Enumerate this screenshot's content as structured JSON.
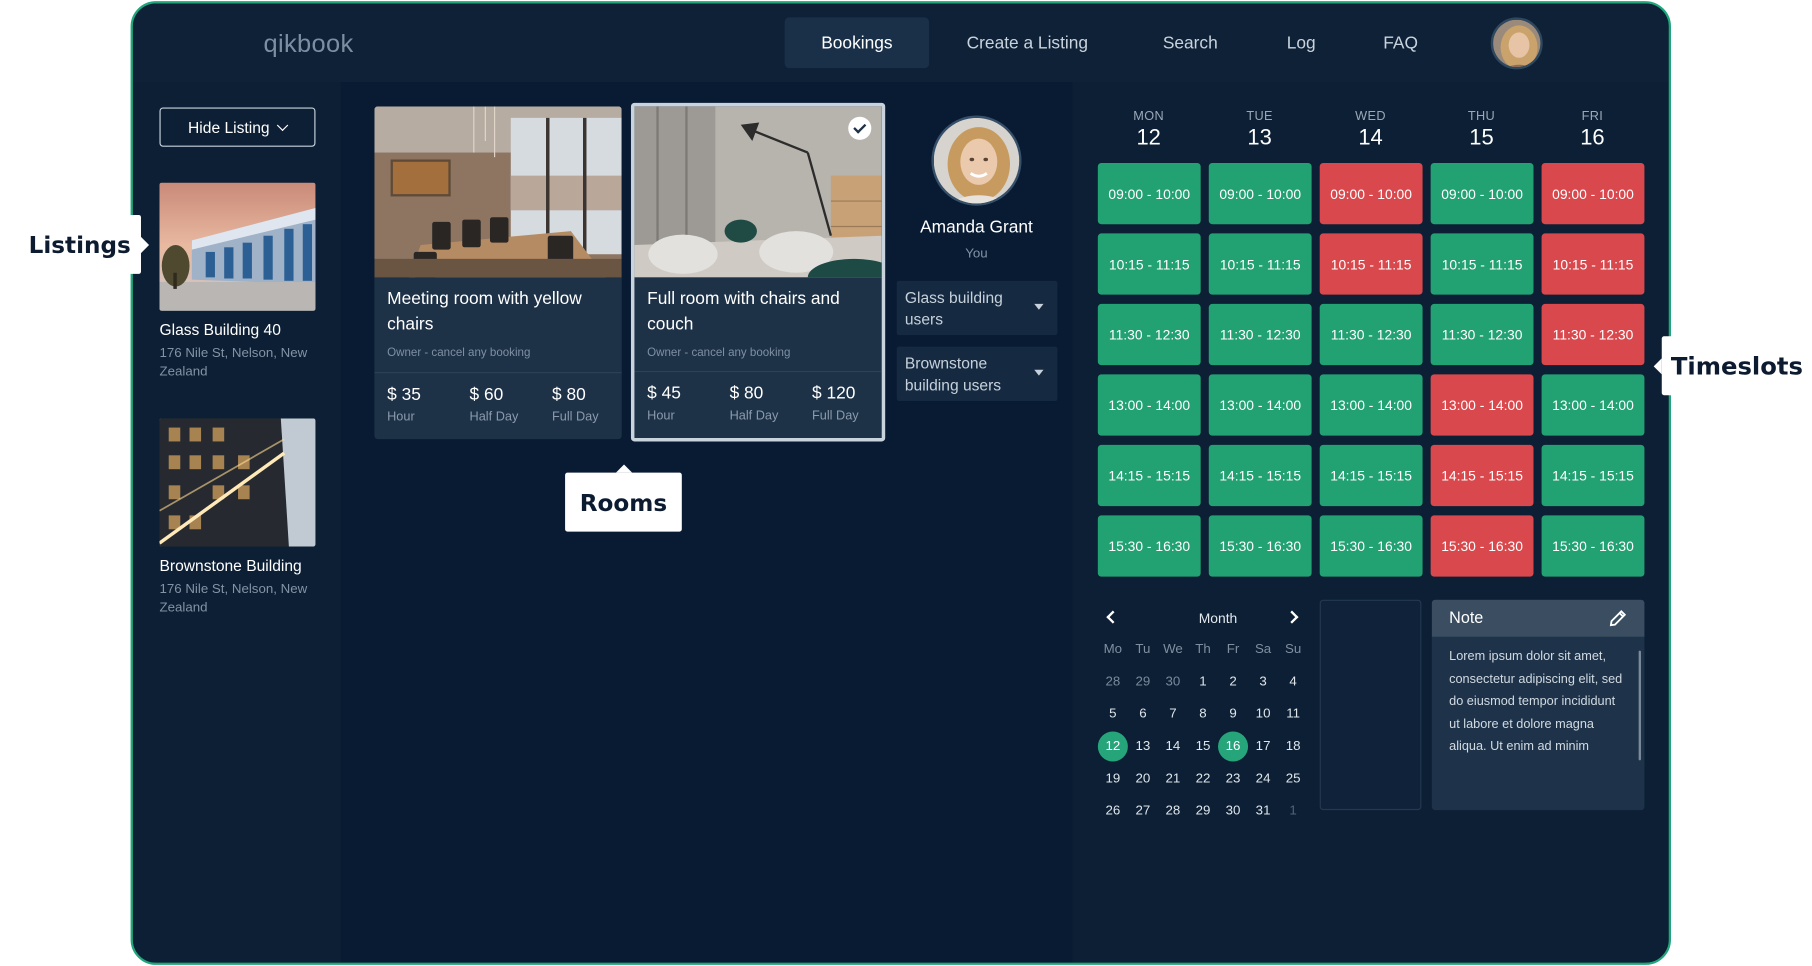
{
  "app": {
    "logo": "qikbook"
  },
  "nav": [
    {
      "label": "Bookings",
      "active": true
    },
    {
      "label": "Create a Listing"
    },
    {
      "label": "Search"
    },
    {
      "label": "Log"
    },
    {
      "label": "FAQ"
    }
  ],
  "sidebar": {
    "hide_button": "Hide Listing",
    "listings": [
      {
        "name": "Glass Building 40",
        "address": "176 Nile St, Nelson, New Zealand"
      },
      {
        "name": "Brownstone Building",
        "address": "176 Nile St, Nelson, New Zealand"
      }
    ]
  },
  "rooms": [
    {
      "title": "Meeting room with yellow chairs",
      "owner": "Owner - cancel any booking",
      "prices": [
        {
          "value": "$ 35",
          "label": "Hour"
        },
        {
          "value": "$ 60",
          "label": "Half Day"
        },
        {
          "value": "$ 80",
          "label": "Full Day"
        }
      ]
    },
    {
      "title": "Full room with chairs and couch",
      "owner": "Owner - cancel any booking",
      "selected": true,
      "prices": [
        {
          "value": "$ 45",
          "label": "Hour"
        },
        {
          "value": "$ 80",
          "label": "Half Day"
        },
        {
          "value": "$ 120",
          "label": "Full Day"
        }
      ]
    }
  ],
  "user": {
    "name": "Amanda Grant",
    "role": "You"
  },
  "user_groups": [
    "Glass building users",
    "Brownstone building users"
  ],
  "schedule": {
    "days": [
      {
        "name": "MON",
        "date": "12"
      },
      {
        "name": "TUE",
        "date": "13"
      },
      {
        "name": "WED",
        "date": "14"
      },
      {
        "name": "THU",
        "date": "15"
      },
      {
        "name": "FRI",
        "date": "16"
      }
    ],
    "times": [
      "09:00 - 10:00",
      "10:15 - 11:15",
      "11:30 - 12:30",
      "13:00 - 14:00",
      "14:15 - 15:15",
      "15:30 - 16:30"
    ],
    "status": [
      [
        "available",
        "available",
        "booked",
        "available",
        "booked"
      ],
      [
        "available",
        "available",
        "booked",
        "available",
        "booked"
      ],
      [
        "available",
        "available",
        "available",
        "available",
        "booked"
      ],
      [
        "available",
        "available",
        "available",
        "booked",
        "available"
      ],
      [
        "available",
        "available",
        "available",
        "booked",
        "available"
      ],
      [
        "available",
        "available",
        "available",
        "booked",
        "available"
      ]
    ]
  },
  "calendar": {
    "title": "Month",
    "weekdays": [
      "Mo",
      "Tu",
      "We",
      "Th",
      "Fr",
      "Sa",
      "Su"
    ],
    "weeks": [
      [
        {
          "d": "28",
          "s": "muted"
        },
        {
          "d": "29",
          "s": "muted"
        },
        {
          "d": "30",
          "s": "muted"
        },
        {
          "d": "1"
        },
        {
          "d": "2"
        },
        {
          "d": "3"
        },
        {
          "d": "4"
        }
      ],
      [
        {
          "d": "5"
        },
        {
          "d": "6"
        },
        {
          "d": "7"
        },
        {
          "d": "8"
        },
        {
          "d": "9"
        },
        {
          "d": "10"
        },
        {
          "d": "11"
        }
      ],
      [
        {
          "d": "12",
          "s": "sel"
        },
        {
          "d": "13"
        },
        {
          "d": "14"
        },
        {
          "d": "15"
        },
        {
          "d": "16",
          "s": "sel"
        },
        {
          "d": "17"
        },
        {
          "d": "18"
        }
      ],
      [
        {
          "d": "19"
        },
        {
          "d": "20"
        },
        {
          "d": "21"
        },
        {
          "d": "22"
        },
        {
          "d": "23"
        },
        {
          "d": "24"
        },
        {
          "d": "25"
        }
      ],
      [
        {
          "d": "26"
        },
        {
          "d": "27"
        },
        {
          "d": "28"
        },
        {
          "d": "29"
        },
        {
          "d": "30"
        },
        {
          "d": "31"
        },
        {
          "d": "1",
          "s": "faint"
        }
      ]
    ]
  },
  "note": {
    "title": "Note",
    "body": "Lorem ipsum dolor sit amet, consectetur adipiscing elit, sed do eiusmod tempor incididunt ut labore et dolore magna aliqua. Ut enim ad minim"
  },
  "callouts": {
    "listings": "Listings",
    "rooms": "Rooms",
    "timeslots": "Timeslots"
  },
  "colors": {
    "available": "#22a173",
    "booked": "#d9484c",
    "accent": "#27a57a",
    "frame": "#20a67a"
  }
}
